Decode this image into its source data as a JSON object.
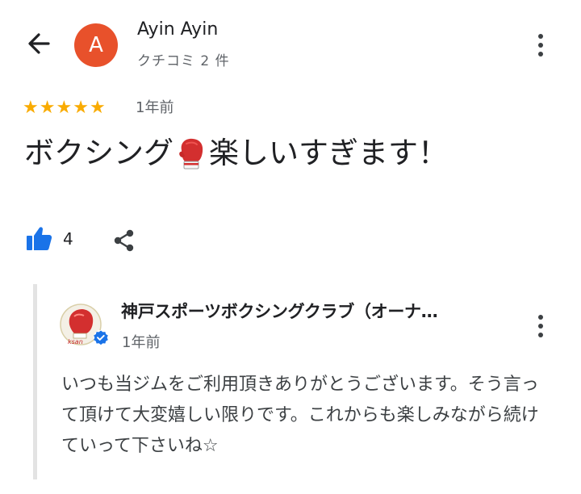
{
  "header": {
    "back_icon": "arrow-left-icon",
    "avatar_letter": "A",
    "avatar_color": "#e8512b",
    "user_name": "Ayin Ayin",
    "user_sub": "クチコミ 2 件",
    "more_icon": "more-vert-icon"
  },
  "review": {
    "rating": 5,
    "rating_max": 5,
    "star_color": "#f9ab00",
    "time": "1年前",
    "text_before": "ボクシング",
    "emoji_icon": "boxing-glove-icon",
    "text_after": "楽しいすぎます！"
  },
  "actions": {
    "like_icon": "thumbs-up-icon",
    "like_count": "4",
    "share_icon": "share-icon",
    "accent_color": "#1a73e8"
  },
  "owner_reply": {
    "name": "神戸スポーツボクシングクラブ（オーナ…",
    "avatar_text": "ksan",
    "verified_icon": "verified-badge-icon",
    "time": "1年前",
    "text": "いつも当ジムをご利用頂きありがとうございます。そう言って頂けて大変嬉しい限りです。これからも楽しみながら続けていって下さいね☆",
    "more_icon": "more-vert-icon"
  }
}
